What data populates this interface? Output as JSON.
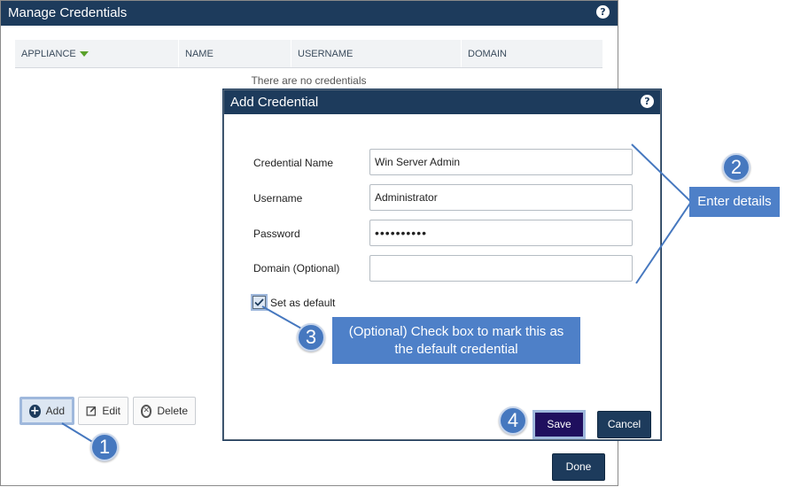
{
  "manage": {
    "title": "Manage Credentials",
    "help_symbol": "?",
    "columns": [
      "APPLIANCE",
      "NAME",
      "USERNAME",
      "DOMAIN"
    ],
    "empty_message": "There are no credentials",
    "buttons": {
      "add": "Add",
      "edit": "Edit",
      "delete": "Delete",
      "done": "Done"
    }
  },
  "add_dialog": {
    "title": "Add Credential",
    "help_symbol": "?",
    "fields": {
      "credential_name": {
        "label": "Credential Name",
        "value": "Win Server Admin"
      },
      "username": {
        "label": "Username",
        "value": "Administrator"
      },
      "password": {
        "label": "Password",
        "value": "••••••••••"
      },
      "domain": {
        "label": "Domain (Optional)",
        "value": ""
      }
    },
    "set_default": {
      "label": "Set as default",
      "checked": true
    },
    "buttons": {
      "save": "Save",
      "cancel": "Cancel"
    }
  },
  "annotations": {
    "step1": "1",
    "step2": "2",
    "step3": "3",
    "step4": "4",
    "callout_details": "Enter details",
    "callout_default_line1": "(Optional) Check box to mark this as",
    "callout_default_line2": "the default credential"
  },
  "colors": {
    "titlebar": "#1d3b5c",
    "callout": "#4e80c8",
    "badge": "#4678bf",
    "sort_arrow": "#5aa12a",
    "save_button": "#1f0f5e"
  },
  "icons": [
    "help-icon",
    "plus-circle-icon",
    "edit-icon",
    "delete-circle-icon",
    "sort-down-icon",
    "checkbox-checked-icon"
  ]
}
